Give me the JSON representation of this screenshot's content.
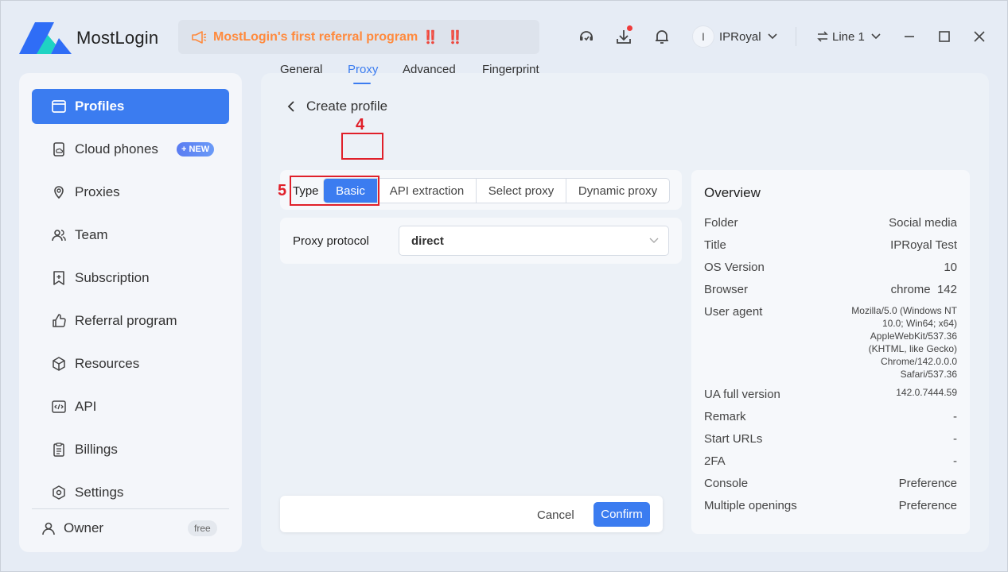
{
  "app": {
    "brand": "MostLogin",
    "banner": {
      "text": "MostLogin's first referral program",
      "marks1": "‼️",
      "marks2": "‼️"
    },
    "user": {
      "initial": "I",
      "name": "IPRoyal"
    },
    "line": "Line 1"
  },
  "sidebar": {
    "items": [
      {
        "label": "Profiles",
        "icon": "browser-window-icon"
      },
      {
        "label": "Cloud phones",
        "icon": "cloud-phone-icon",
        "badge": "+ NEW"
      },
      {
        "label": "Proxies",
        "icon": "location-pin-icon"
      },
      {
        "label": "Team",
        "icon": "team-icon"
      },
      {
        "label": "Subscription",
        "icon": "subscription-icon"
      },
      {
        "label": "Referral program",
        "icon": "thumbs-up-icon"
      },
      {
        "label": "Resources",
        "icon": "cube-icon"
      },
      {
        "label": "API",
        "icon": "code-icon"
      },
      {
        "label": "Billings",
        "icon": "clipboard-icon"
      },
      {
        "label": "Settings",
        "icon": "gear-icon"
      }
    ],
    "owner": {
      "label": "Owner",
      "badge": "free"
    }
  },
  "main": {
    "back_title": "Create profile",
    "tabs": [
      "General",
      "Proxy",
      "Advanced",
      "Fingerprint"
    ],
    "annotations": {
      "tab": "4",
      "type": "5"
    },
    "type": {
      "label": "Type",
      "options": [
        "Basic",
        "API extraction",
        "Select proxy",
        "Dynamic proxy"
      ]
    },
    "protocol": {
      "label": "Proxy protocol",
      "value": "direct"
    },
    "footer": {
      "cancel": "Cancel",
      "confirm": "Confirm"
    }
  },
  "overview": {
    "title": "Overview",
    "rows": [
      {
        "key": "Folder",
        "value": "Social media"
      },
      {
        "key": "Title",
        "value": "IPRoyal Test"
      },
      {
        "key": "OS Version",
        "value": "10"
      },
      {
        "key": "Browser",
        "value": "chrome  142"
      },
      {
        "key": "User agent",
        "value": "Mozilla/5.0 (Windows NT 10.0; Win64; x64) AppleWebKit/537.36 (KHTML, like Gecko) Chrome/142.0.0.0 Safari/537.36"
      },
      {
        "key": "UA full version",
        "value": "142.0.7444.59"
      },
      {
        "key": "Remark",
        "value": "-"
      },
      {
        "key": "Start URLs",
        "value": "-"
      },
      {
        "key": "2FA",
        "value": "-"
      },
      {
        "key": "Console",
        "value": "Preference"
      },
      {
        "key": "Multiple openings",
        "value": "Preference"
      }
    ]
  },
  "colors": {
    "accent": "#3b7cf0",
    "annotation": "#e0202a",
    "banner_text": "#ff8a3d"
  }
}
